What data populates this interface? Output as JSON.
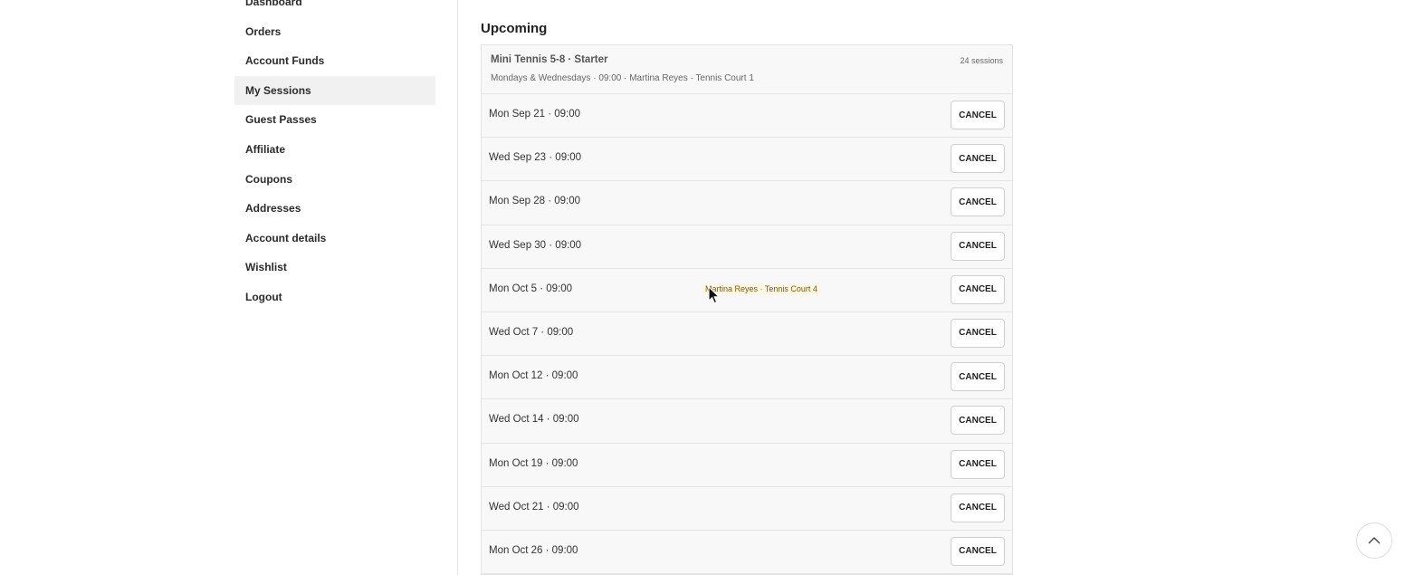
{
  "sidebar": {
    "items": [
      {
        "label": "Dashboard"
      },
      {
        "label": "Orders"
      },
      {
        "label": "Account Funds"
      },
      {
        "label": "My Sessions"
      },
      {
        "label": "Guest Passes"
      },
      {
        "label": "Affiliate"
      },
      {
        "label": "Coupons"
      },
      {
        "label": "Addresses"
      },
      {
        "label": "Account details"
      },
      {
        "label": "Wishlist"
      },
      {
        "label": "Logout"
      }
    ],
    "active": "My Sessions"
  },
  "main": {
    "section_title": "Upcoming",
    "course": {
      "name": "Mini Tennis 5-8 · Starter",
      "meta": "Mondays & Wednesdays · 09:00 · Martina Reyes · Tennis Court 1",
      "session_count": "24 sessions"
    },
    "cancel_label": "CANCEL",
    "sessions": [
      {
        "date": "Mon Sep 21 · 09:00"
      },
      {
        "date": "Wed Sep 23 · 09:00"
      },
      {
        "date": "Mon Sep 28 · 09:00"
      },
      {
        "date": "Wed Sep 30 · 09:00"
      },
      {
        "date": "Mon Oct 5 · 09:00"
      },
      {
        "date": "Wed Oct 7 · 09:00"
      },
      {
        "date": "Mon Oct 12 · 09:00"
      },
      {
        "date": "Wed Oct 14 · 09:00"
      },
      {
        "date": "Mon Oct 19 · 09:00"
      },
      {
        "date": "Wed Oct 21 · 09:00"
      },
      {
        "date": "Mon Oct 26 · 09:00"
      }
    ],
    "tooltip": "Martina Reyes · Tennis Court 4"
  },
  "icons": {
    "scroll_top": "chevron-up-icon",
    "cursor": "mouse-pointer-icon"
  }
}
